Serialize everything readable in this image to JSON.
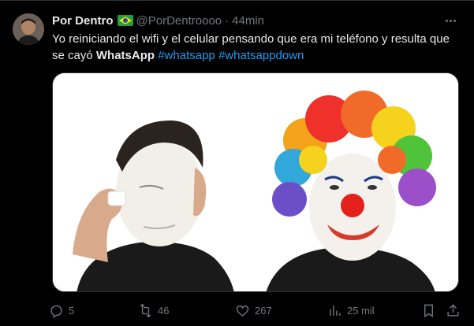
{
  "tweet": {
    "author_name": "Por Dentro",
    "author_flag": "brazil-flag-icon",
    "handle": "@PorDentroooo",
    "separator": "·",
    "time": "44min",
    "text_part1": "Yo reiniciando el wifi y el celular pensando que era mi teléfono y resulta que se cayó ",
    "text_bold": "WhatsApp",
    "hashtags": [
      "#whatsapp",
      "#whatsappdown"
    ]
  },
  "actions": {
    "replies": "5",
    "reposts": "46",
    "likes": "267",
    "views": "25 mil"
  },
  "colors": {
    "background": "#000000",
    "text": "#e7e9ea",
    "muted": "#71767b",
    "link": "#1d9bf0"
  },
  "icons": [
    "more-icon",
    "reply-icon",
    "repost-icon",
    "like-icon",
    "views-icon",
    "bookmark-icon",
    "share-icon"
  ]
}
